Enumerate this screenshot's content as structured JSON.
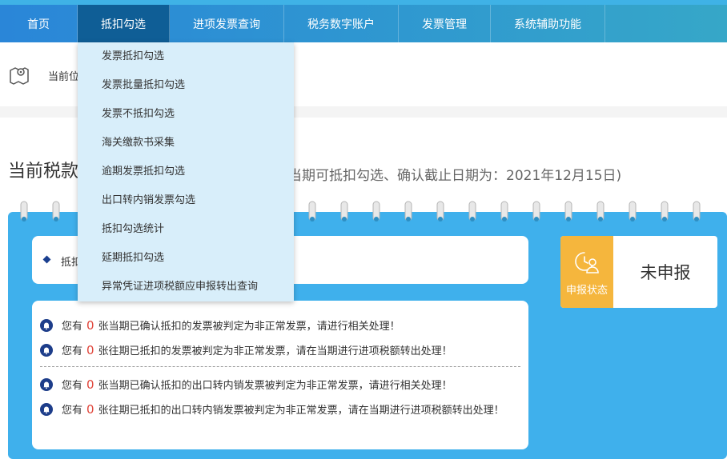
{
  "nav": {
    "items": [
      {
        "label": "首页"
      },
      {
        "label": "抵扣勾选"
      },
      {
        "label": "进项发票查询"
      },
      {
        "label": "税务数字账户"
      },
      {
        "label": "发票管理"
      },
      {
        "label": "系统辅助功能"
      }
    ]
  },
  "dropdown": {
    "items": [
      {
        "label": "发票抵扣勾选"
      },
      {
        "label": "发票批量抵扣勾选"
      },
      {
        "label": "发票不抵扣勾选"
      },
      {
        "label": "海关缴款书采集"
      },
      {
        "label": "逾期发票抵扣勾选"
      },
      {
        "label": "出口转内销发票勾选"
      },
      {
        "label": "抵扣勾选统计"
      },
      {
        "label": "延期抵扣勾选"
      },
      {
        "label": "异常凭证进项税额应申报转出查询"
      }
    ]
  },
  "breadcrumb": {
    "text": "当前位"
  },
  "period": {
    "title": "当前税款",
    "note": "当期可抵扣勾选、确认截止日期为：2021年12月15日)"
  },
  "info": {
    "text": "抵扣"
  },
  "notices": [
    {
      "prefix": "您有",
      "count": "0",
      "suffix": "张当期已确认抵扣的发票被判定为非正常发票，请进行相关处理！"
    },
    {
      "prefix": "您有",
      "count": "0",
      "suffix": "张往期已抵扣的发票被判定为非正常发票，请在当期进行进项税额转出处理！"
    },
    {
      "prefix": "您有",
      "count": "0",
      "suffix": "张当期已确认抵扣的出口转内销发票被判定为非正常发票，请进行相关处理！"
    },
    {
      "prefix": "您有",
      "count": "0",
      "suffix": "张往期已抵扣的出口转内销发票被判定为非正常发票，请在当期进行进项税额转出处理！"
    }
  ],
  "status": {
    "label": "申报状态",
    "value": "未申报",
    "icon": "person-clock-icon"
  },
  "colors": {
    "nav_active": "#0f5e96",
    "panel": "#3fb0ec",
    "status_accent": "#f5b63d",
    "count": "#e0453a"
  }
}
